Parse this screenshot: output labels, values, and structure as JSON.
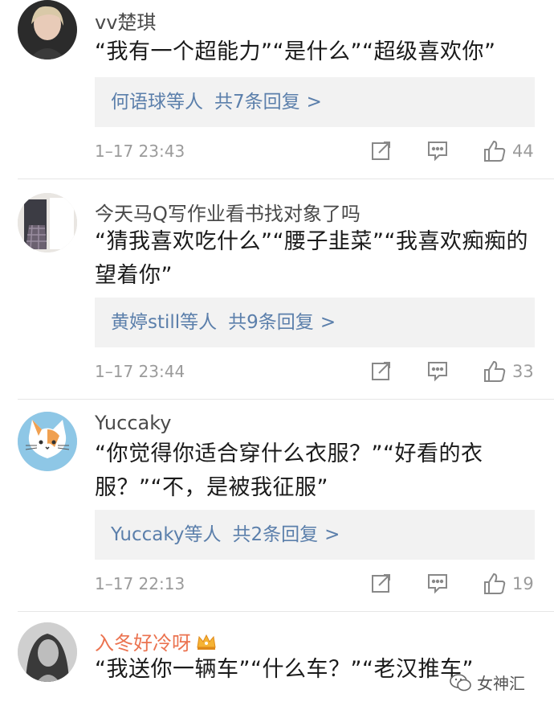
{
  "comments": [
    {
      "user": "vv楚琪",
      "text": "“我有一个超能力”“是什么”“超级喜欢你”",
      "reply_users": "何语球等人",
      "reply_count": "共7条回复",
      "chevron": ">",
      "time": "1–17 23:43",
      "likes": "44"
    },
    {
      "user": "今天马Q写作业看书找对象了吗",
      "text": "“猜我喜欢吃什么”“腰子韭菜”“我喜欢痴痴的望着你”",
      "reply_users": "黄婷still等人",
      "reply_count": "共9条回复",
      "chevron": ">",
      "time": "1–17 23:44",
      "likes": "33"
    },
    {
      "user": "Yuccaky",
      "text": "“你觉得你适合穿什么衣服？”“好看的衣服？”“不，是被我征服”",
      "reply_users": "Yuccaky等人",
      "reply_count": "共2条回复",
      "chevron": ">",
      "time": "1–17 22:13",
      "likes": "19"
    },
    {
      "user": "入冬好冷呀",
      "text": "“我送你一辆车”“什么车？”“老汉推车”"
    }
  ],
  "watermark": "女神汇",
  "colors": {
    "link": "#5b7fab",
    "vip_name": "#eb7350",
    "meta": "#9b9b9b",
    "reply_bg": "#f2f2f2"
  },
  "icons": [
    "share-icon",
    "comment-icon",
    "thumbs-up-icon",
    "crown-icon",
    "wechat-icon"
  ]
}
